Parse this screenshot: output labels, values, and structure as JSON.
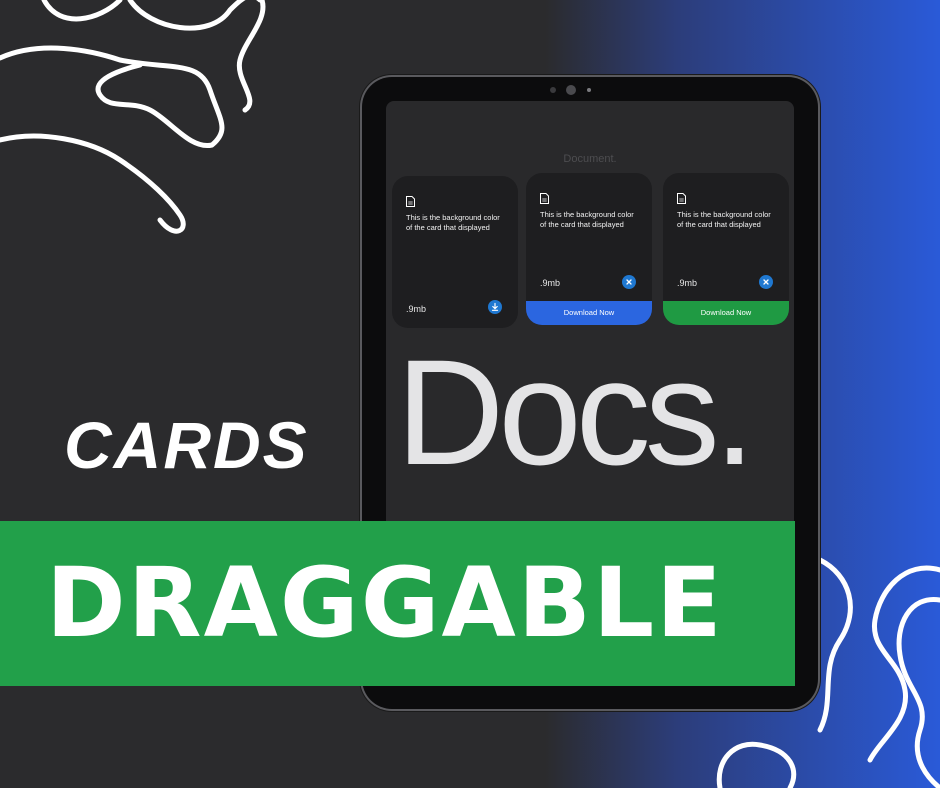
{
  "screen": {
    "document_label": "Document.",
    "cards": [
      {
        "description": "This is the background color of the card that displayed",
        "size": ".9mb",
        "action_icon": "download-icon",
        "download_label": null,
        "download_color": null
      },
      {
        "description": "This is the background color of the card that displayed",
        "size": ".9mb",
        "action_icon": "close-icon",
        "download_label": "Download Now",
        "download_color": "#2b66e0"
      },
      {
        "description": "This is the background color of the card that displayed",
        "size": ".9mb",
        "action_icon": "close-icon",
        "download_label": "Download Now",
        "download_color": "#1f9a43"
      }
    ],
    "title": "Docs."
  },
  "poster": {
    "cards_heading": "CARDS",
    "banner_text": "DRAGGABLE",
    "banner_color": "#22a04a",
    "accent_blue": "#2a5ad8"
  }
}
